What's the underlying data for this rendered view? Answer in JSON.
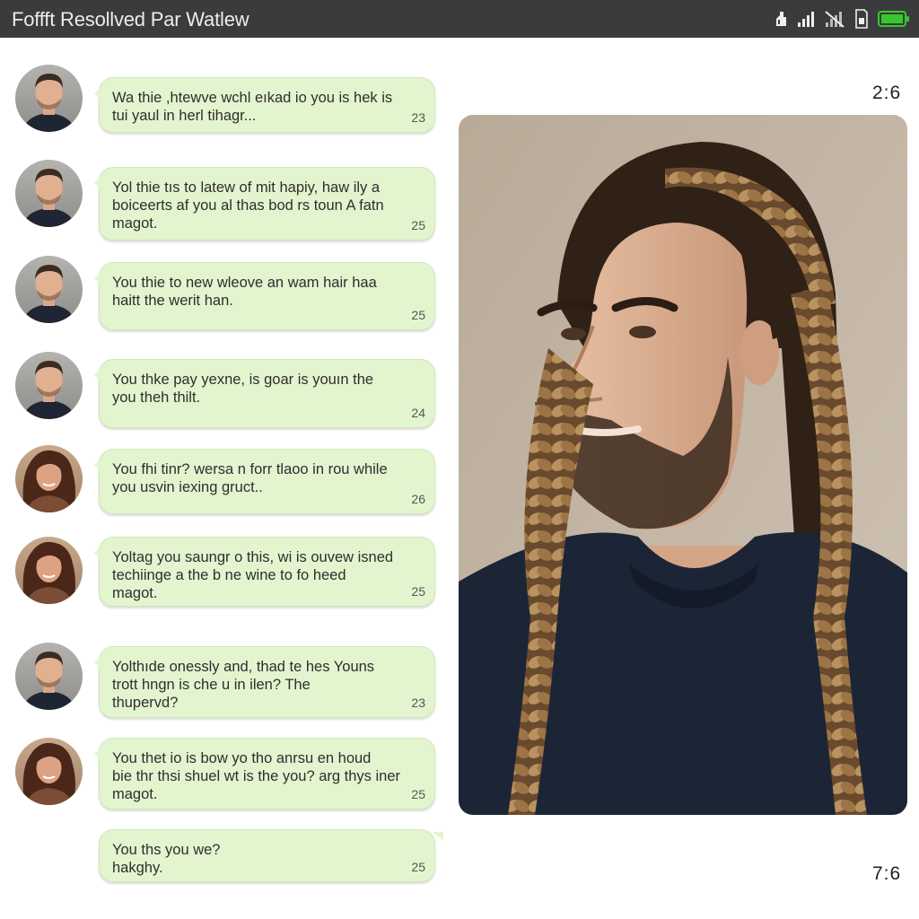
{
  "header": {
    "title": "Foffft Resollved Par Watlew",
    "icons": [
      "signal-alt-icon",
      "signal-bars-icon",
      "no-signal-icon",
      "sim-icon",
      "battery-icon"
    ]
  },
  "colors": {
    "header_bg": "#3a3b3d",
    "bubble_bg": "#e3f5cf",
    "battery": "#36c82e"
  },
  "messages": [
    {
      "avatar": "male",
      "text": "Wa thie ,htewve wchl eıkad io you is hek is\ntui yaul in herl tihagr...",
      "time": "23"
    },
    {
      "avatar": "male",
      "text": "Yol thie tıs to latew of mit hapiy, haw ily a\nboiceerts af you al thas bod rs toun A fatn\nmagot.",
      "time": "25"
    },
    {
      "avatar": "male",
      "text": "You thie to new wleove an wam hair haa\nhaitt the werit han.",
      "time": "25"
    },
    {
      "avatar": "male",
      "text": "You thke pay yexne, is goar is youın the\nyou theh thilt.",
      "time": "24"
    },
    {
      "avatar": "female",
      "text": "You fhi tinr? wersa n forr tlaoo in rou while\nyou usvin iexing gruct..",
      "time": "26"
    },
    {
      "avatar": "female",
      "text": "Yoltag you saungr o this, wi is ouvew isned\ntechiinge a the b ne wine to fo heed\nmagot.",
      "time": "25"
    },
    {
      "avatar": "male",
      "text": "Yolthıde onessly and, thad te hes Youns\ntrott hngn is che u in ilen? The\nthupervd?",
      "time": "23"
    },
    {
      "avatar": "female",
      "text": "You thet io is bow yo tho anrsu en houd\nbie thr thsi shuel wt is the you? arg thys iner\nmagot.",
      "time": "25"
    },
    {
      "avatar": "none",
      "text": "You ths you we?\nhakghy.",
      "time": "25"
    }
  ],
  "timestamps": {
    "top": "2:6",
    "bottom": "7:6"
  },
  "photo": {
    "subject": "man-with-braids-photo"
  }
}
